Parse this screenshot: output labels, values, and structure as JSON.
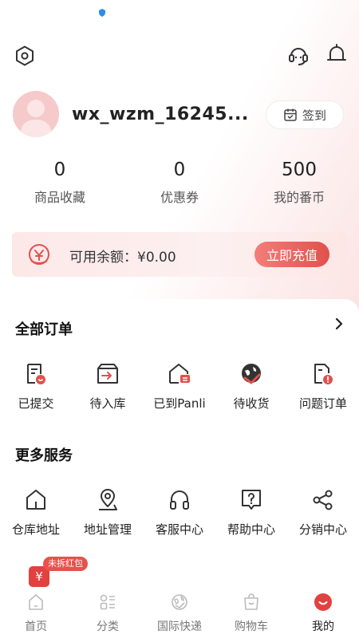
{
  "colors": {
    "accent": "#e2504d",
    "balance_bg": "#fde8e8",
    "avatar_bg": "#f6c9cb"
  },
  "header": {
    "icons": [
      "settings-icon",
      "customer-service-icon",
      "notification-bell-icon"
    ]
  },
  "profile": {
    "username": "wx_wzm_16245...",
    "checkin_label": "签到"
  },
  "stats": [
    {
      "value": "0",
      "label": "商品收藏"
    },
    {
      "value": "0",
      "label": "优惠券"
    },
    {
      "value": "500",
      "label": "我的番币"
    }
  ],
  "balance": {
    "text": "可用余额：¥0.00",
    "button": "立即充值"
  },
  "orders": {
    "title": "全部订单",
    "items": [
      {
        "label": "已提交",
        "icon": "submitted-order-icon"
      },
      {
        "label": "待入库",
        "icon": "pending-warehouse-icon"
      },
      {
        "label": "已到Panli",
        "icon": "arrived-panli-icon"
      },
      {
        "label": "待收货",
        "icon": "pending-receive-icon"
      },
      {
        "label": "问题订单",
        "icon": "problem-order-icon"
      }
    ]
  },
  "services": {
    "title": "更多服务",
    "items": [
      {
        "label": "仓库地址",
        "icon": "warehouse-icon"
      },
      {
        "label": "地址管理",
        "icon": "location-pin-icon"
      },
      {
        "label": "客服中心",
        "icon": "headset-icon"
      },
      {
        "label": "帮助中心",
        "icon": "help-icon"
      },
      {
        "label": "分销中心",
        "icon": "share-icon"
      }
    ]
  },
  "red_packet": {
    "symbol": "¥",
    "tag": "未拆红包"
  },
  "tabbar": [
    {
      "label": "首页",
      "icon": "home-icon",
      "active": false
    },
    {
      "label": "分类",
      "icon": "category-icon",
      "active": false
    },
    {
      "label": "国际快递",
      "icon": "global-express-icon",
      "active": false
    },
    {
      "label": "购物车",
      "icon": "cart-icon",
      "active": false
    },
    {
      "label": "我的",
      "icon": "profile-icon",
      "active": true
    }
  ]
}
